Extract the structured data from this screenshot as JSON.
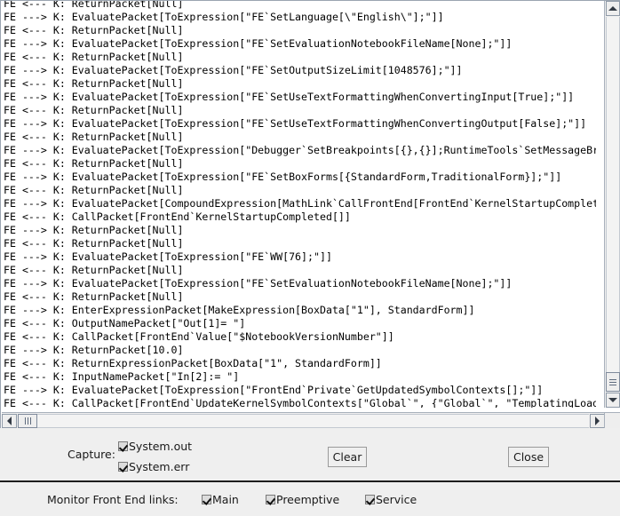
{
  "window": {
    "kind": "mathematica-kernel-link-monitor"
  },
  "log": {
    "lines": [
      "FE <--- K: ReturnPacket[Null]",
      "FE ---> K: EvaluatePacket[ToExpression[\"FE`SetLanguage[\\\"English\\\"];\"]]",
      "FE <--- K: ReturnPacket[Null]",
      "FE ---> K: EvaluatePacket[ToExpression[\"FE`SetEvaluationNotebookFileName[None];\"]]",
      "FE <--- K: ReturnPacket[Null]",
      "FE ---> K: EvaluatePacket[ToExpression[\"FE`SetOutputSizeLimit[1048576];\"]]",
      "FE <--- K: ReturnPacket[Null]",
      "FE ---> K: EvaluatePacket[ToExpression[\"FE`SetUseTextFormattingWhenConvertingInput[True];\"]]",
      "FE <--- K: ReturnPacket[Null]",
      "FE ---> K: EvaluatePacket[ToExpression[\"FE`SetUseTextFormattingWhenConvertingOutput[False];\"]]",
      "FE <--- K: ReturnPacket[Null]",
      "FE ---> K: EvaluatePacket[ToExpression[\"Debugger`SetBreakpoints[{},{}];RuntimeTools`SetMessageBre",
      "FE <--- K: ReturnPacket[Null]",
      "FE ---> K: EvaluatePacket[ToExpression[\"FE`SetBoxForms[{StandardForm,TraditionalForm}];\"]]",
      "FE <--- K: ReturnPacket[Null]",
      "FE ---> K: EvaluatePacket[CompoundExpression[MathLink`CallFrontEnd[FrontEnd`KernelStartupComplete",
      "FE <--- K: CallPacket[FrontEnd`KernelStartupCompleted[]]",
      "FE ---> K: ReturnPacket[Null]",
      "FE <--- K: ReturnPacket[Null]",
      "FE ---> K: EvaluatePacket[ToExpression[\"FE`WW[76];\"]]",
      "FE <--- K: ReturnPacket[Null]",
      "FE ---> K: EvaluatePacket[ToExpression[\"FE`SetEvaluationNotebookFileName[None];\"]]",
      "FE <--- K: ReturnPacket[Null]",
      "FE ---> K: EnterExpressionPacket[MakeExpression[BoxData[\"1\"], StandardForm]]",
      "FE <--- K: OutputNamePacket[\"Out[1]= \"]",
      "FE <--- K: CallPacket[FrontEnd`Value[\"$NotebookVersionNumber\"]]",
      "FE ---> K: ReturnPacket[10.0]",
      "FE <--- K: ReturnExpressionPacket[BoxData[\"1\", StandardForm]]",
      "FE <--- K: InputNamePacket[\"In[2]:= \"]",
      "FE ---> K: EvaluatePacket[ToExpression[\"FrontEnd`Private`GetUpdatedSymbolContexts[];\"]]",
      "FE <--- K: CallPacket[FrontEnd`UpdateKernelSymbolContexts[\"Global`\", {\"Global`\", \"TemplatingLoade"
    ]
  },
  "scrollbars": {
    "vertical": {
      "up_icon": "triangle-up-icon",
      "down_icon": "triangle-down-icon"
    },
    "horizontal": {
      "left_icon": "triangle-left-icon",
      "right_icon": "triangle-right-icon"
    }
  },
  "capture": {
    "label": "Capture:",
    "options": [
      {
        "label": "System.out",
        "checked": true
      },
      {
        "label": "System.err",
        "checked": true
      }
    ],
    "clear_label": "Clear",
    "close_label": "Close"
  },
  "monitor": {
    "label": "Monitor Front End links:",
    "options": [
      {
        "label": "Main",
        "checked": true
      },
      {
        "label": "Preemptive",
        "checked": true
      },
      {
        "label": "Service",
        "checked": true
      }
    ]
  },
  "colors": {
    "panel_bg": "#efefef",
    "log_bg": "#ffffff",
    "text": "#000000",
    "border": "#9aa4b0",
    "divider": "#1d1d1d"
  }
}
